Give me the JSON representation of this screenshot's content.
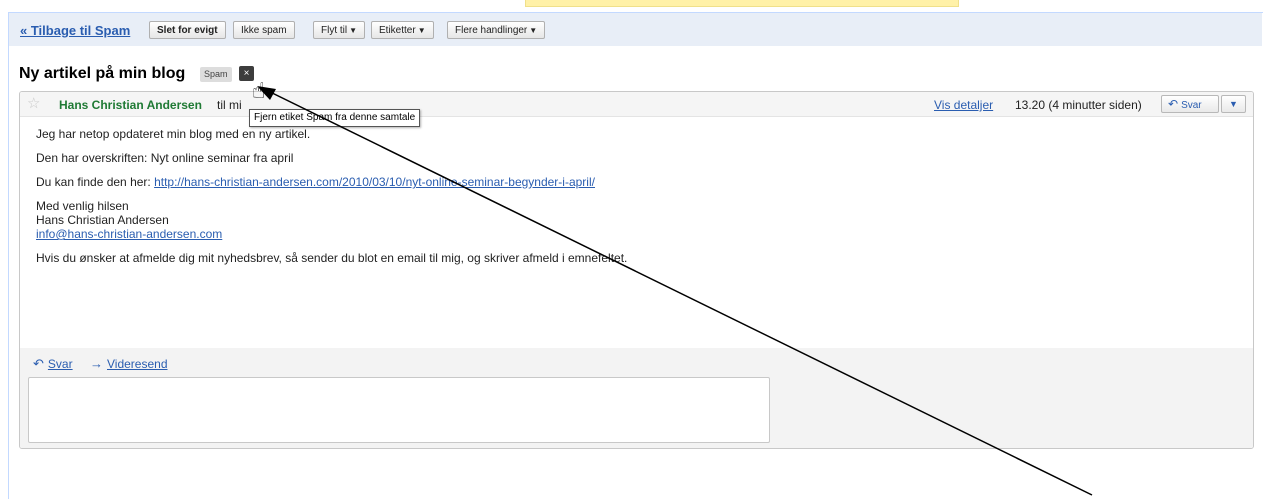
{
  "toolbar": {
    "back_label": "« Tilbage til Spam",
    "delete_forever": "Slet for evigt",
    "not_spam": "Ikke spam",
    "move_to": "Flyt til",
    "labels": "Etiketter",
    "more_actions": "Flere handlinger",
    "caret": "▼"
  },
  "thread": {
    "subject": "Ny artikel på min blog",
    "label": "Spam",
    "remove_label_icon": "×",
    "tooltip": "Fjern etiket Spam fra denne samtale"
  },
  "message": {
    "star_icon": "☆",
    "sender": "Hans Christian Andersen",
    "recipient_text": "til mi",
    "details_link": "Vis detaljer",
    "timestamp": "13.20 (4 minutter siden)",
    "reply_button": "Svar",
    "menu_caret": "▼",
    "body": {
      "line1": "Jeg har netop opdateret min blog med en ny artikel.",
      "line2": "Den har overskriften: Nyt online seminar fra april",
      "line3_prefix": "Du kan finde den her: ",
      "line3_link": "http://hans-christian-andersen.com/2010/03/10/nyt-online-seminar-begynder-i-april/",
      "sig_greeting": "Med venlig hilsen",
      "sig_name": "Hans Christian Andersen",
      "sig_email": "info@hans-christian-andersen.com",
      "unsubscribe": "Hvis du ønsker at afmelde dig mit nyhedsbrev, så sender du blot en email til mig, og skriver afmeld i emnefeltet."
    }
  },
  "footer": {
    "reply_link": "Svar",
    "forward_link": "Videresend",
    "reply_arrow": "↶",
    "forward_arrow": "→"
  },
  "icons": {
    "reply_icon": "reply-arrow-icon",
    "forward_icon": "forward-arrow-icon",
    "star_icon": "star-icon",
    "cursor_icon": "hand-cursor-icon"
  },
  "colors": {
    "sender": "#1f7a34",
    "link": "#2a5db0",
    "toolbar_bg": "#e8eef7",
    "tooltip_border": "#555555"
  }
}
